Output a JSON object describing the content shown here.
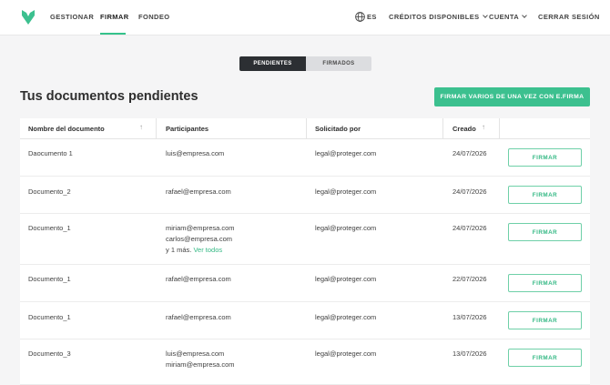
{
  "nav": {
    "items": [
      {
        "label": "GESTIONAR"
      },
      {
        "label": "FIRMAR"
      },
      {
        "label": "FONDEO"
      }
    ],
    "language": "ES",
    "credits": "CRÉDITOS DISPONIBLES",
    "account": "CUENTA",
    "logout": "CERRAR SESIÓN",
    "accent": "#35c28b"
  },
  "tabs": {
    "pending": "PENDIENTES",
    "signed": "FIRMADOS"
  },
  "page": {
    "title": "Tus documentos pendientes",
    "bulk_sign": "FIRMAR VARIOS DE UNA VEZ CON E.FIRMA"
  },
  "table": {
    "headers": {
      "name": "Nombre del documento",
      "participants": "Participantes",
      "requested_by": "Solicitado por",
      "created": "Creado"
    },
    "sign_label": "FIRMAR",
    "rows": [
      {
        "name": "Daocumento 1",
        "participants": [
          "luis@empresa.com"
        ],
        "more": "",
        "requested_by": "legal@proteger.com",
        "created": "24/07/2026"
      },
      {
        "name": "Documento_2",
        "participants": [
          "rafael@empresa.com"
        ],
        "more": "",
        "requested_by": "legal@proteger.com",
        "created": "24/07/2026"
      },
      {
        "name": "Documento_1",
        "participants": [
          "miriam@empresa.com",
          "carlos@empresa.com"
        ],
        "more": "y 1 más.",
        "more_link": "Ver todos",
        "requested_by": "legal@proteger.com",
        "created": "24/07/2026"
      },
      {
        "name": "Documento_1",
        "participants": [
          "rafael@empresa.com"
        ],
        "more": "",
        "requested_by": "legal@proteger.com",
        "created": "22/07/2026"
      },
      {
        "name": "Documento_1",
        "participants": [
          "rafael@empresa.com"
        ],
        "more": "",
        "requested_by": "legal@proteger.com",
        "created": "13/07/2026"
      },
      {
        "name": "Documento_3",
        "participants": [
          "luis@empresa.com",
          "miriam@empresa.com"
        ],
        "more": "",
        "requested_by": "legal@proteger.com",
        "created": "13/07/2026"
      }
    ]
  }
}
